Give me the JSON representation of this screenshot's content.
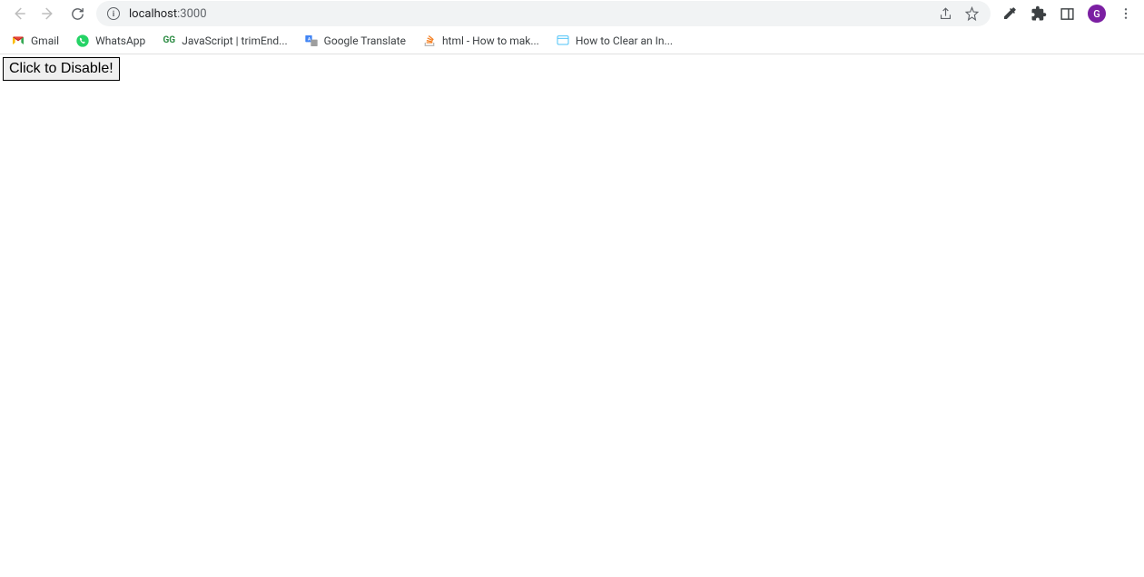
{
  "browser": {
    "url_host": "localhost",
    "url_port": ":3000",
    "profile_initial": "G"
  },
  "bookmarks": [
    {
      "label": "Gmail",
      "icon": "gmail"
    },
    {
      "label": "WhatsApp",
      "icon": "whatsapp"
    },
    {
      "label": "JavaScript | trimEnd...",
      "icon": "gfg"
    },
    {
      "label": "Google Translate",
      "icon": "translate"
    },
    {
      "label": "html - How to mak...",
      "icon": "stackoverflow"
    },
    {
      "label": "How to Clear an In...",
      "icon": "generic"
    }
  ],
  "page": {
    "button_label": "Click to Disable!"
  }
}
